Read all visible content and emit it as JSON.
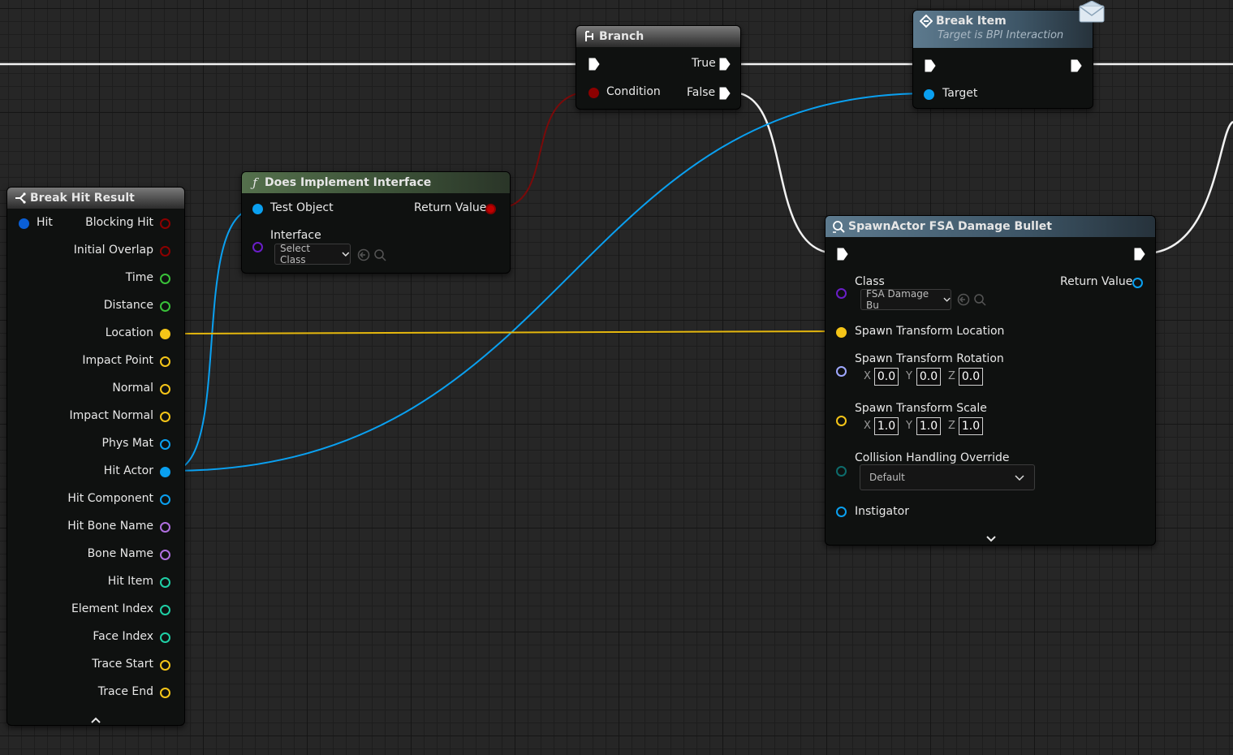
{
  "break_hit_result": {
    "title": "Break Hit Result",
    "input_label": "Hit",
    "outputs": [
      "Blocking Hit",
      "Initial Overlap",
      "Time",
      "Distance",
      "Location",
      "Impact Point",
      "Normal",
      "Impact Normal",
      "Phys Mat",
      "Hit Actor",
      "Hit Component",
      "Hit Bone Name",
      "Bone Name",
      "Hit Item",
      "Element Index",
      "Face Index",
      "Trace Start",
      "Trace End"
    ],
    "collapse_icon": "chevron-up-icon"
  },
  "does_implement_interface": {
    "title": "Does Implement Interface",
    "test_object_label": "Test Object",
    "interface_label": "Interface",
    "select_class_value": "Select Class",
    "return_value_label": "Return Value"
  },
  "branch": {
    "title": "Branch",
    "condition_label": "Condition",
    "true_label": "True",
    "false_label": "False"
  },
  "break_item": {
    "title": "Break Item",
    "subtitle": "Target is BPI Interaction",
    "target_label": "Target"
  },
  "spawn_actor": {
    "title": "SpawnActor FSA Damage Bullet",
    "class_label": "Class",
    "class_value": "FSA Damage Bu",
    "return_value_label": "Return Value",
    "location_label": "Spawn Transform Location",
    "rotation_label": "Spawn Transform Rotation",
    "rotation": {
      "x": "0.0",
      "y": "0.0",
      "z": "0.0"
    },
    "scale_label": "Spawn Transform Scale",
    "scale": {
      "x": "1.0",
      "y": "1.0",
      "z": "1.0"
    },
    "axis_x": "X",
    "axis_y": "Y",
    "axis_z": "Z",
    "collision_label": "Collision Handling Override",
    "collision_value": "Default",
    "instigator_label": "Instigator",
    "expand_icon": "chevron-down-icon"
  },
  "colors": {
    "exec": "#ffffff",
    "bool": "#8c0000",
    "object": "#0aa0f0",
    "vector": "#f5c518",
    "float": "#39c139",
    "rotator": "#9fa8ff",
    "name": "#b06fe0",
    "int": "#1fd0a6",
    "class": "#6a1ec8",
    "struct": "#0a5fd6"
  }
}
